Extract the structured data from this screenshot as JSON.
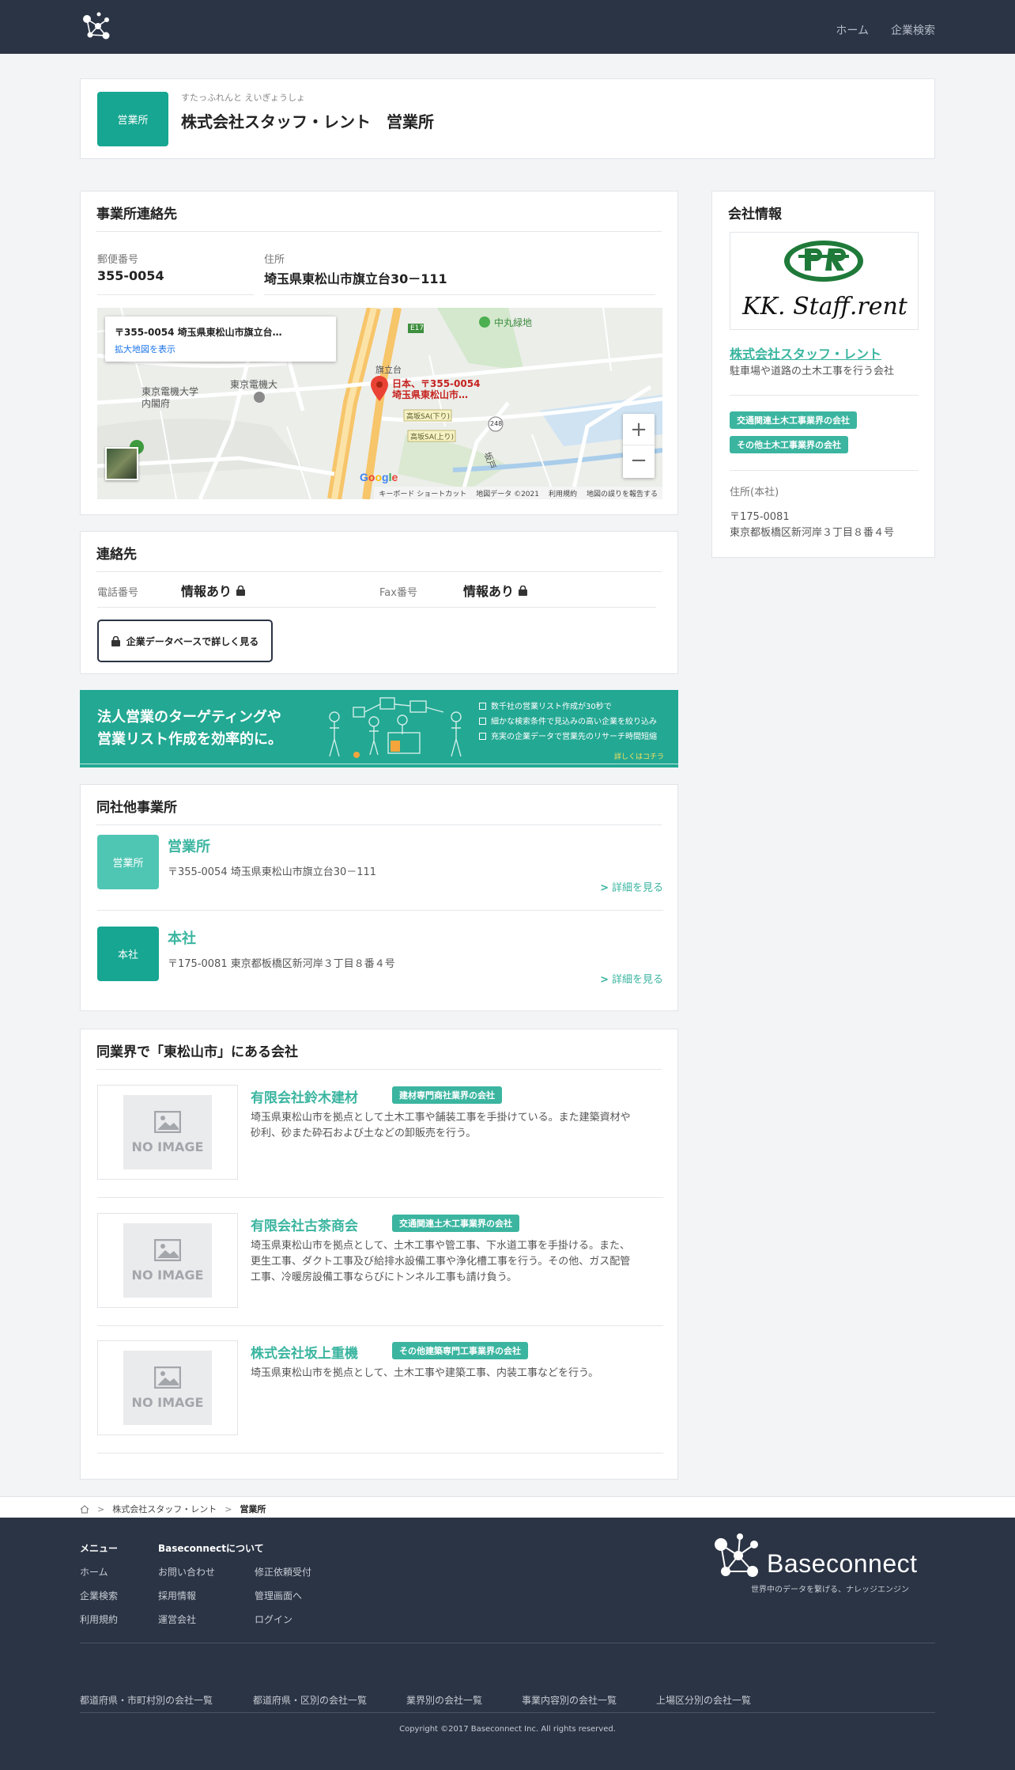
{
  "header": {
    "nav": [
      "ホーム",
      "企業検索"
    ]
  },
  "office": {
    "badge": "営業所",
    "reading": "すたっふれんと えいぎょうしょ",
    "name": "株式会社スタッフ・レント　営業所"
  },
  "contact_section": {
    "title": "事業所連絡先",
    "postal_label": "郵便番号",
    "postal_value": "355-0054",
    "address_label": "住所",
    "address_value": "埼玉県東松山市旗立台30－111"
  },
  "map": {
    "popup_title": "〒355-0054 埼玉県東松山市旗立台…",
    "popup_link": "拡大地図を表示",
    "labels": [
      "中丸緑地",
      "東京電機大学",
      "内閣府",
      "東京電機大",
      "旗立台",
      "高坂SA(下り)",
      "高坂SA(上り)",
      "E17",
      "248",
      "坂戸"
    ],
    "marker_label_1": "日本、〒355-0054",
    "marker_label_2": "埼玉県東松山市…",
    "zoom_in": "+",
    "zoom_out": "−",
    "footer": [
      "キーボード ショートカット",
      "地図データ ©2021",
      "利用規約",
      "地図の誤りを報告する"
    ]
  },
  "phone_section": {
    "title": "連絡先",
    "tel_label": "電話番号",
    "tel_value": "情報あり",
    "fax_label": "Fax番号",
    "fax_value": "情報あり",
    "db_button": "企業データベースで詳しく見る"
  },
  "banner": {
    "headline_1": "法人営業のターゲティングや",
    "headline_2": "営業リスト作成を効率的に。",
    "checks": [
      "数千社の営業リスト作成が30秒で",
      "細かな検索条件で見込みの高い企業を絞り込み",
      "充実の企業データで営業先のリサーチ時間短縮"
    ],
    "cta": "詳しくはコチラ"
  },
  "other_offices": {
    "title": "同社他事業所",
    "items": [
      {
        "badge": "営業所",
        "name": "営業所",
        "address": "〒355-0054 埼玉県東松山市旗立台30－111",
        "detail": "詳細を見る"
      },
      {
        "badge": "本社",
        "name": "本社",
        "address": "〒175-0081 東京都板橋区新河岸３丁目８番４号",
        "detail": "詳細を見る"
      }
    ]
  },
  "same_industry": {
    "title": "同業界で「東松山市」にある会社",
    "noimage": "NO IMAGE",
    "items": [
      {
        "name": "有限会社鈴木建材",
        "tag": "建材専門商社業界の会社",
        "desc_1": "埼玉県東松山市を拠点として土木工事や舗装工事を手掛けている。また建築資材や",
        "desc_2": "砂利、砂また砕石および土などの卸販売を行う。",
        "desc_3": ""
      },
      {
        "name": "有限会社古茶商会",
        "tag": "交通関連土木工事業界の会社",
        "desc_1": "埼玉県東松山市を拠点として、土木工事や管工事、下水道工事を手掛ける。また、",
        "desc_2": "更生工事、ダクト工事及び給排水設備工事や浄化槽工事を行う。その他、ガス配管",
        "desc_3": "工事、冷暖房設備工事ならびにトンネル工事も請け負う。"
      },
      {
        "name": "株式会社坂上重機",
        "tag": "その他建築専門工事業界の会社",
        "desc_1": "埼玉県東松山市を拠点として、土木工事や建築工事、内装工事などを行う。",
        "desc_2": "",
        "desc_3": ""
      }
    ]
  },
  "company_info": {
    "title": "会社情報",
    "logo_text": "KK. Staff.rent",
    "name": "株式会社スタッフ・レント",
    "desc": "駐車場や道路の土木工事を行う会社",
    "tags": [
      "交通関連土木工事業界の会社",
      "その他土木工事業界の会社"
    ],
    "address_label": "住所(本社)",
    "postal": "〒175-0081",
    "address": "東京都板橋区新河岸３丁目８番４号"
  },
  "breadcrumb": [
    "株式会社スタッフ・レント",
    "営業所"
  ],
  "footer": {
    "menu_title": "メニュー",
    "menu": [
      "ホーム",
      "企業検索",
      "利用規約"
    ],
    "about_title": "Baseconnectについて",
    "about_1": [
      "お問い合わせ",
      "採用情報",
      "運営会社"
    ],
    "about_2": [
      "修正依頼受付",
      "管理画面へ",
      "ログイン"
    ],
    "brand": "Baseconnect",
    "tagline": "世界中のデータを繋げる、ナレッジエンジン",
    "links": [
      "都道府県・市町村別の会社一覧",
      "都道府県・区別の会社一覧",
      "業界別の会社一覧",
      "事業内容別の会社一覧",
      "上場区分別の会社一覧"
    ],
    "copyright": "Copyright ©2017 Baseconnect Inc. All rights reserved."
  },
  "colors": {
    "header_bg": "#2b3445",
    "teal": "#3bb5a0",
    "badge_dark": "#16a691",
    "badge_light": "#4fc6b3"
  }
}
